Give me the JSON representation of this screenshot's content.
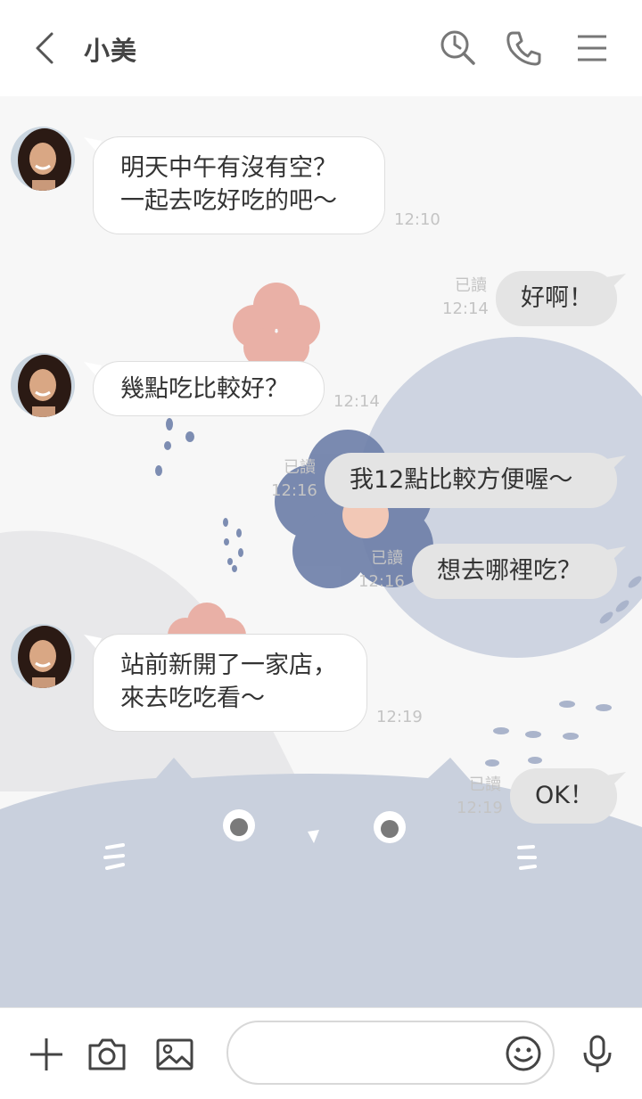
{
  "header": {
    "title": "小美",
    "icons": [
      "back-icon",
      "search-history-icon",
      "phone-icon",
      "menu-icon"
    ]
  },
  "messages": [
    {
      "side": "in",
      "lines": [
        "明天中午有沒有空？",
        "一起去吃好吃的吧～"
      ],
      "time": "12:10"
    },
    {
      "side": "out",
      "lines": [
        "好啊！"
      ],
      "read": "已讀",
      "time": "12:14"
    },
    {
      "side": "in",
      "lines": [
        "幾點吃比較好？"
      ],
      "time": "12:14"
    },
    {
      "side": "out",
      "lines": [
        "我12點比較方便喔～"
      ],
      "read": "已讀",
      "time": "12:16"
    },
    {
      "side": "out",
      "lines": [
        "想去哪裡吃？"
      ],
      "read": "已讀",
      "time": "12:16"
    },
    {
      "side": "in",
      "lines": [
        "站前新開了一家店，",
        "來去吃吃看～"
      ],
      "time": "12:19"
    },
    {
      "side": "out",
      "lines": [
        "OK！"
      ],
      "read": "已讀",
      "time": "12:19"
    }
  ],
  "footer": {
    "input_value": "",
    "icons": [
      "plus-icon",
      "camera-icon",
      "image-icon",
      "emoji-icon",
      "microphone-icon"
    ]
  },
  "colors": {
    "incoming_bubble": "#ffffff",
    "outgoing_bubble": "#e4e4e4",
    "wallpaper_blue": "#c5ccdb",
    "wallpaper_navy": "#6d7fa8",
    "wallpaper_pink": "#e8a9a0"
  }
}
